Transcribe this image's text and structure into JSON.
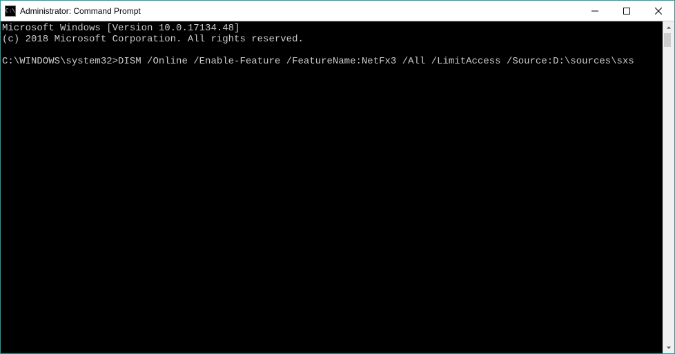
{
  "titlebar": {
    "icon_label": "C:\\",
    "title": "Administrator: Command Prompt"
  },
  "terminal": {
    "banner_line1": "Microsoft Windows [Version 10.0.17134.48]",
    "banner_line2": "(c) 2018 Microsoft Corporation. All rights reserved.",
    "prompt": "C:\\WINDOWS\\system32>",
    "command": "DISM /Online /Enable-Feature /FeatureName:NetFx3 /All /LimitAccess /Source:D:\\sources\\sxs"
  }
}
